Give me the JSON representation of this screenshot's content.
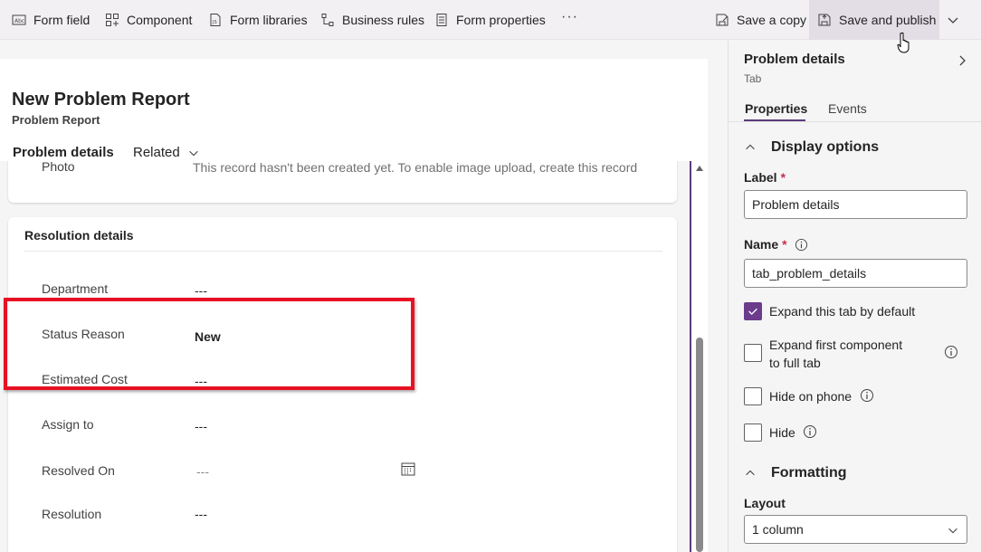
{
  "toolbar": {
    "form_field": "Form field",
    "component": "Component",
    "form_libraries": "Form libraries",
    "business_rules": "Business rules",
    "form_properties": "Form properties",
    "more": "···",
    "save_copy": "Save a copy",
    "save_publish": "Save and publish"
  },
  "record": {
    "title": "New Problem Report",
    "subtitle": "Problem Report",
    "tabs": [
      "Problem details",
      "Related"
    ]
  },
  "photo": {
    "label": "Photo",
    "message": "This record hasn't been created yet. To enable image upload, create this record"
  },
  "resolution": {
    "title": "Resolution details",
    "fields": [
      {
        "label": "Department",
        "value": "---"
      },
      {
        "label": "Status Reason",
        "value": "New"
      },
      {
        "label": "Estimated Cost",
        "value": "---"
      },
      {
        "label": "Assign to",
        "value": "---"
      },
      {
        "label": "Resolved On",
        "value": "---"
      },
      {
        "label": "Resolution",
        "value": "---"
      }
    ]
  },
  "panel": {
    "title": "Problem details",
    "subtitle": "Tab",
    "tabs": [
      "Properties",
      "Events"
    ],
    "display_options": "Display options",
    "label_caption": "Label",
    "label_value": "Problem details",
    "name_caption": "Name",
    "name_value": "tab_problem_details",
    "checkboxes": [
      {
        "text": "Expand this tab by default",
        "checked": true
      },
      {
        "text": "Expand first component to full tab",
        "checked": false
      },
      {
        "text": "Hide on phone",
        "checked": false
      },
      {
        "text": "Hide",
        "checked": false
      }
    ],
    "formatting": "Formatting",
    "layout_caption": "Layout",
    "layout_value": "1 column"
  },
  "colors": {
    "accent": "#6b3b8c",
    "highlight": "#e81123"
  }
}
